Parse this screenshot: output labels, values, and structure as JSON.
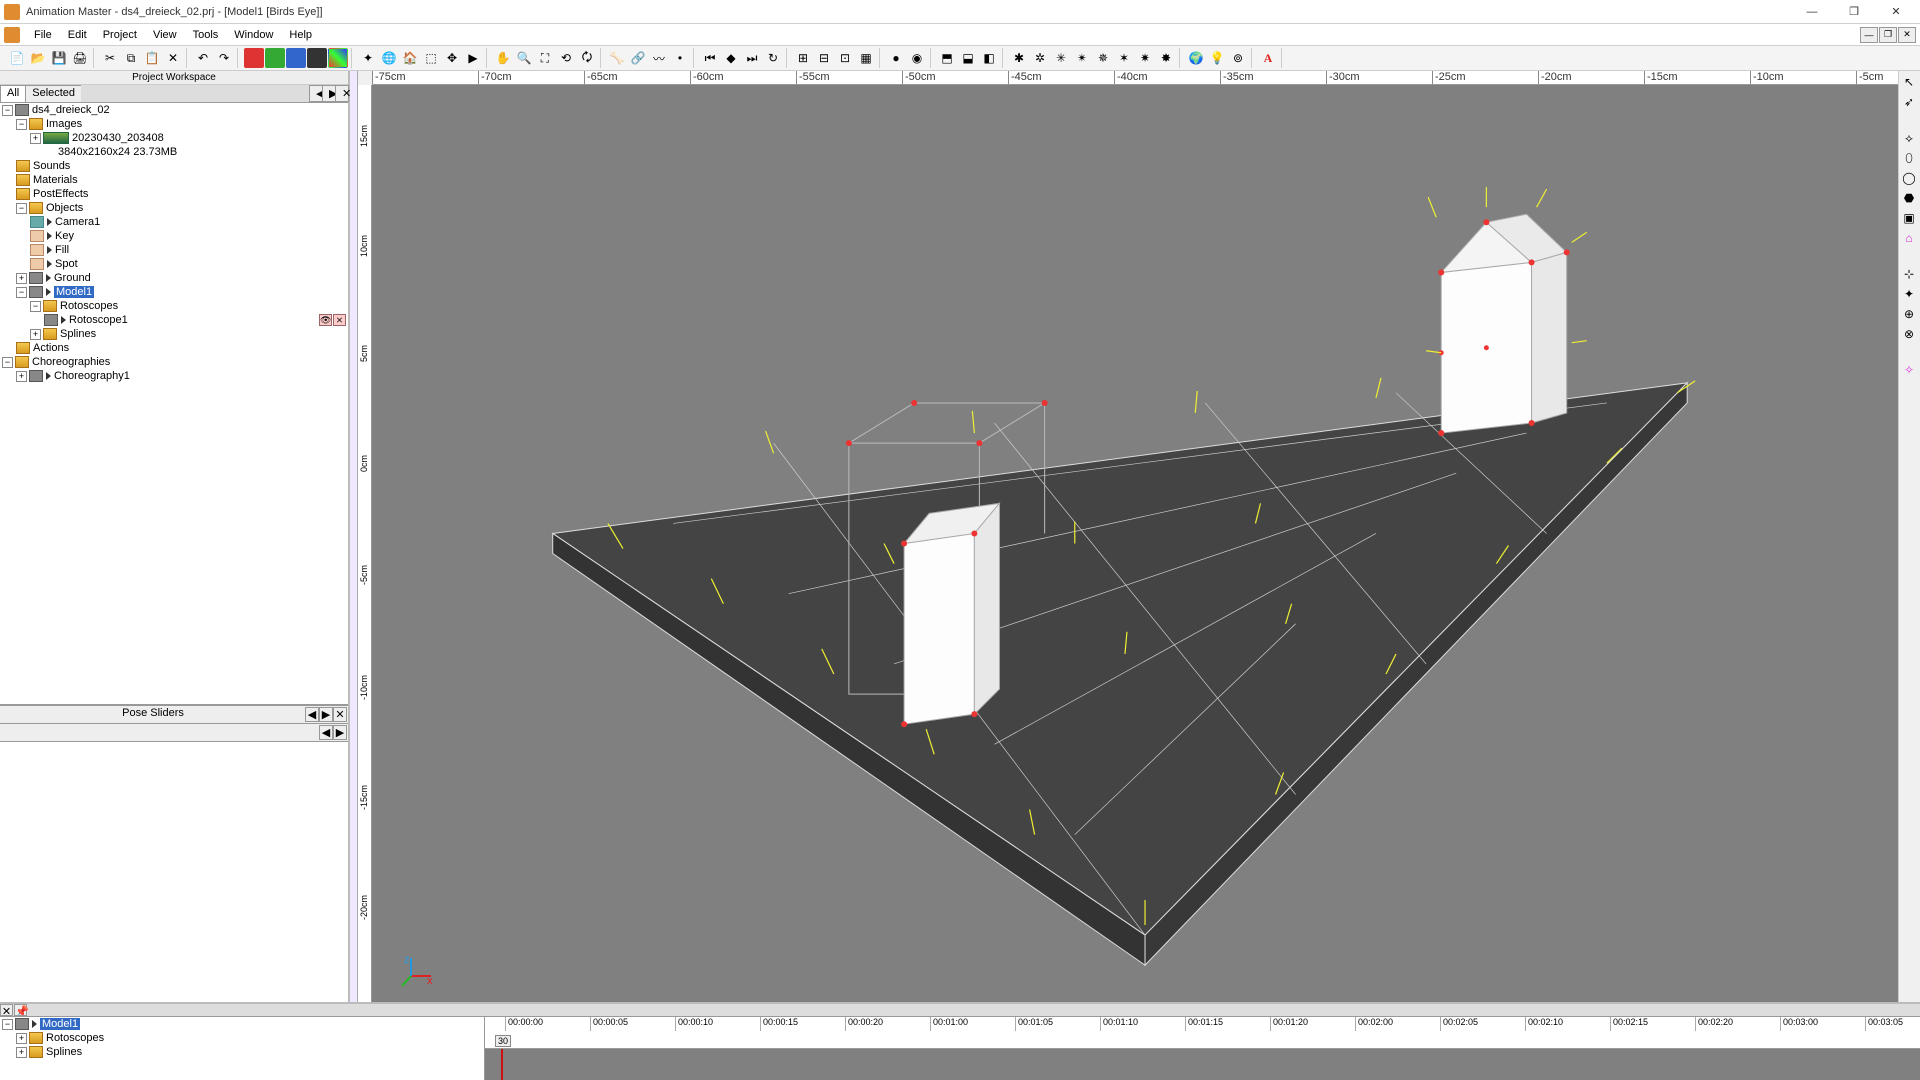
{
  "title": "Animation Master - ds4_dreieck_02.prj - [Model1 [Birds Eye]]",
  "menu": {
    "file": "File",
    "edit": "Edit",
    "project": "Project",
    "view": "View",
    "tools": "Tools",
    "window": "Window",
    "help": "Help"
  },
  "workspace": {
    "header": "Project Workspace",
    "tabs": {
      "all": "All",
      "selected": "Selected"
    },
    "project": "ds4_dreieck_02",
    "images_folder": "Images",
    "image_name": "20230430_203408",
    "image_meta": "3840x2160x24 23.73MB",
    "sounds": "Sounds",
    "materials": "Materials",
    "posteffects": "PostEffects",
    "objects": "Objects",
    "camera": "Camera1",
    "key": "Key",
    "fill": "Fill",
    "spot": "Spot",
    "ground": "Ground",
    "model": "Model1",
    "rotoscopes": "Rotoscopes",
    "rotoscope1": "Rotoscope1",
    "splines": "Splines",
    "actions": "Actions",
    "choreographies": "Choreographies",
    "choreo1": "Choreography1"
  },
  "pose_header": "Pose Sliders",
  "ruler_h": [
    "-75cm",
    "-70cm",
    "-65cm",
    "-60cm",
    "-55cm",
    "-50cm",
    "-45cm",
    "-40cm",
    "-35cm",
    "-30cm",
    "-25cm",
    "-20cm",
    "-15cm",
    "-10cm",
    "-5cm"
  ],
  "ruler_v_labels": [
    "15cm",
    "10cm",
    "5cm",
    "0cm",
    "-5cm",
    "-10cm",
    "-15cm",
    "-20cm"
  ],
  "timeline": {
    "ticks": [
      "00:00:00",
      "00:00:05",
      "00:00:10",
      "00:00:15",
      "00:00:20",
      "00:01:00",
      "00:01:05",
      "00:01:10",
      "00:01:15",
      "00:01:20",
      "00:02:00",
      "00:02:05",
      "00:02:10",
      "00:02:15",
      "00:02:20",
      "00:03:00",
      "00:03:05"
    ],
    "frame": "30",
    "model": "Model1",
    "rotoscopes": "Rotoscopes",
    "splines": "Splines"
  },
  "axis": {
    "x": "x",
    "z": "z"
  }
}
